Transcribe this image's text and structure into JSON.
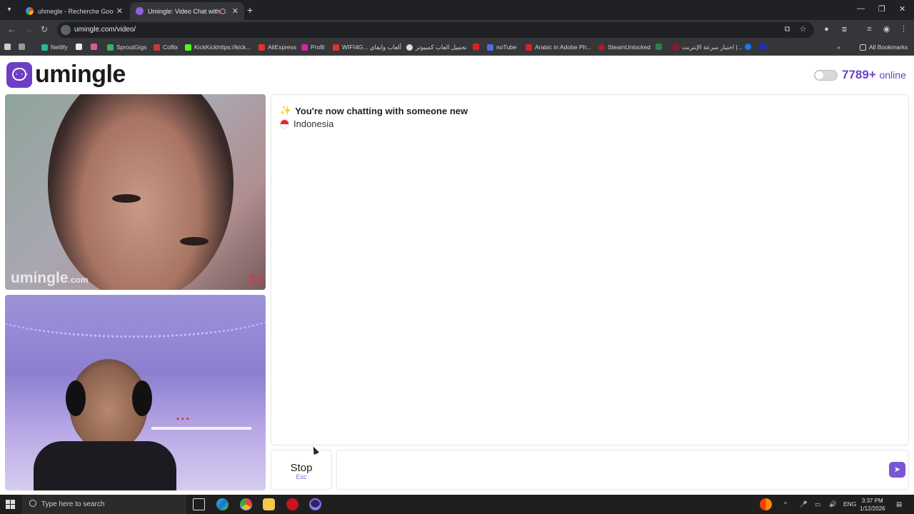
{
  "browser": {
    "tabs": [
      {
        "title": "uhmegle - Recherche Google",
        "active": false
      },
      {
        "title": "Umingle: Video Chat with S",
        "active": true
      }
    ],
    "new_tab": "+",
    "address": "umingle.com/video/",
    "bookmarks": [
      "Netlify",
      "SproutGigs",
      "Coflix",
      "KickKickhttps://kick...",
      "AliExpress",
      "Profil",
      "WIFI4G... ألعاب وايفاي",
      "تحميل العاب كمبيوتر",
      "noTube",
      "Arabic in Adobe Ph...",
      "SteamUnlocked",
      "اختبار سرعة الإنترنت |..."
    ],
    "all_bookmarks": "All Bookmarks"
  },
  "site": {
    "logo_text": "umingle",
    "online_count": "7789+",
    "online_label": "online",
    "brand_color": "#6b43c6"
  },
  "video": {
    "watermark": "umingle",
    "watermark_suffix": ".com"
  },
  "chat": {
    "status_message": "You're now chatting with someone new",
    "country": "Indonesia",
    "input_value": ""
  },
  "controls": {
    "stop_label": "Stop",
    "stop_shortcut": "Esc"
  },
  "taskbar": {
    "search_placeholder": "Type here to search",
    "language": "ENG",
    "time": "3:37 PM",
    "date": "1/12/2026"
  }
}
